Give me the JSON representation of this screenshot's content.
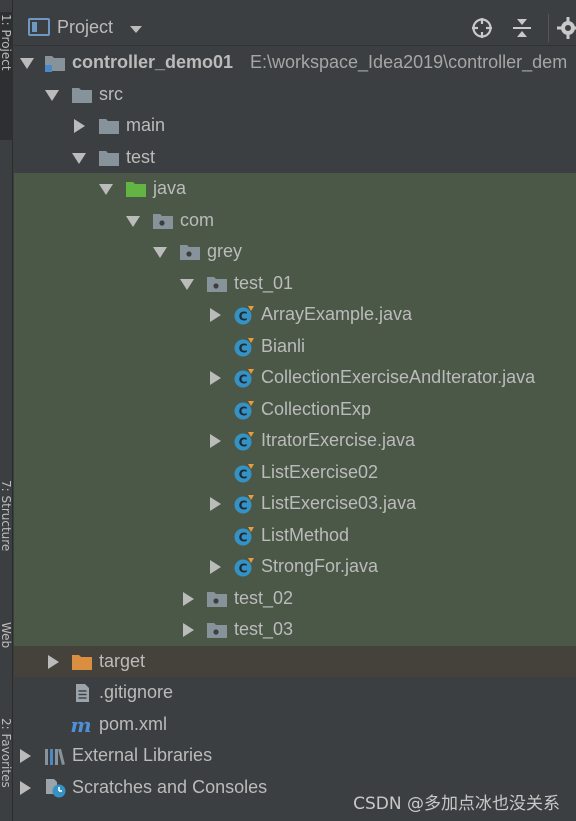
{
  "sidebar": {
    "tabs": [
      {
        "label": "1: Project"
      },
      {
        "label": "7: Structure"
      },
      {
        "label": "Web"
      },
      {
        "label": "2: Favorites"
      }
    ]
  },
  "header": {
    "title": "Project",
    "icons": [
      "project-view-icon",
      "dropdown-caret-icon",
      "locate-icon",
      "collapse-all-icon",
      "settings-icon"
    ]
  },
  "tree": {
    "rows": [
      {
        "label": "controller_demo01",
        "extra": "E:\\workspace_Idea2019\\controller_dem",
        "icon": "module-folder-icon",
        "toggle": "expanded"
      },
      {
        "label": "src",
        "icon": "folder-icon",
        "toggle": "expanded"
      },
      {
        "label": "main",
        "icon": "folder-icon",
        "toggle": "collapsed"
      },
      {
        "label": "test",
        "icon": "folder-icon",
        "toggle": "expanded"
      },
      {
        "label": "java",
        "icon": "test-sources-folder-icon",
        "toggle": "expanded"
      },
      {
        "label": "com",
        "icon": "package-icon",
        "toggle": "expanded"
      },
      {
        "label": "grey",
        "icon": "package-icon",
        "toggle": "expanded"
      },
      {
        "label": "test_01",
        "icon": "package-icon",
        "toggle": "expanded"
      },
      {
        "label": "ArrayExample.java",
        "icon": "java-class-icon",
        "toggle": "collapsed"
      },
      {
        "label": "Bianli",
        "icon": "java-class-icon",
        "toggle": "none"
      },
      {
        "label": "CollectionExerciseAndIterator.java",
        "icon": "java-class-icon",
        "toggle": "collapsed"
      },
      {
        "label": "CollectionExp",
        "icon": "java-class-icon",
        "toggle": "none"
      },
      {
        "label": "ItratorExercise.java",
        "icon": "java-class-icon",
        "toggle": "collapsed"
      },
      {
        "label": "ListExercise02",
        "icon": "java-class-icon",
        "toggle": "none"
      },
      {
        "label": "ListExercise03.java",
        "icon": "java-class-icon",
        "toggle": "collapsed"
      },
      {
        "label": "ListMethod",
        "icon": "java-class-icon",
        "toggle": "none"
      },
      {
        "label": "StrongFor.java",
        "icon": "java-class-icon",
        "toggle": "collapsed"
      },
      {
        "label": "test_02",
        "icon": "package-icon",
        "toggle": "collapsed"
      },
      {
        "label": "test_03",
        "icon": "package-icon",
        "toggle": "collapsed"
      },
      {
        "label": "target",
        "icon": "excluded-folder-icon",
        "toggle": "collapsed"
      },
      {
        "label": ".gitignore",
        "icon": "text-file-icon",
        "toggle": "none"
      },
      {
        "label": "pom.xml",
        "icon": "maven-icon",
        "toggle": "none"
      },
      {
        "label": "External Libraries",
        "icon": "libraries-icon",
        "toggle": "collapsed"
      },
      {
        "label": "Scratches and Consoles",
        "icon": "scratches-icon",
        "toggle": "collapsed"
      }
    ]
  },
  "watermark": "CSDN @多加点冰也没关系",
  "colors": {
    "panel_bg": "#3c3f41",
    "test_highlight": "#4b5848",
    "excluded_highlight": "#45423c",
    "folder_gray": "#87939a",
    "test_folder_green": "#62b543",
    "excluded_folder_orange": "#d98f3f",
    "java_class_blue": "#3592c4",
    "maven_blue": "#4f8fd8"
  }
}
